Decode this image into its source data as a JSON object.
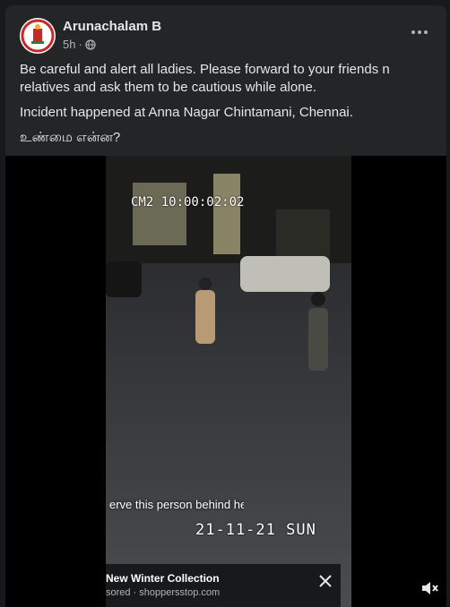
{
  "post": {
    "author": "Arunachalam B",
    "time": "5h",
    "audience_icon": "globe-icon",
    "text_lines": [
      "Be careful and alert all ladies.  Please forward to your friends n relatives and ask them to be cautious while alone.",
      "Incident happened at Anna Nagar Chintamani, Chennai.",
      "உண்மை என்ன?"
    ]
  },
  "video": {
    "camera_timestamp": "CM2 10:00:02:02",
    "caption": "erve this person behind her",
    "date_stamp": "21-11-21 SUN",
    "ad": {
      "title": "New Winter Collection",
      "subtitle": "sored · shoppersstop.com"
    }
  },
  "colors": {
    "page_bg": "#18191a",
    "card_bg": "#242526",
    "primary_text": "#e4e6eb",
    "secondary_text": "#b0b3b8"
  }
}
